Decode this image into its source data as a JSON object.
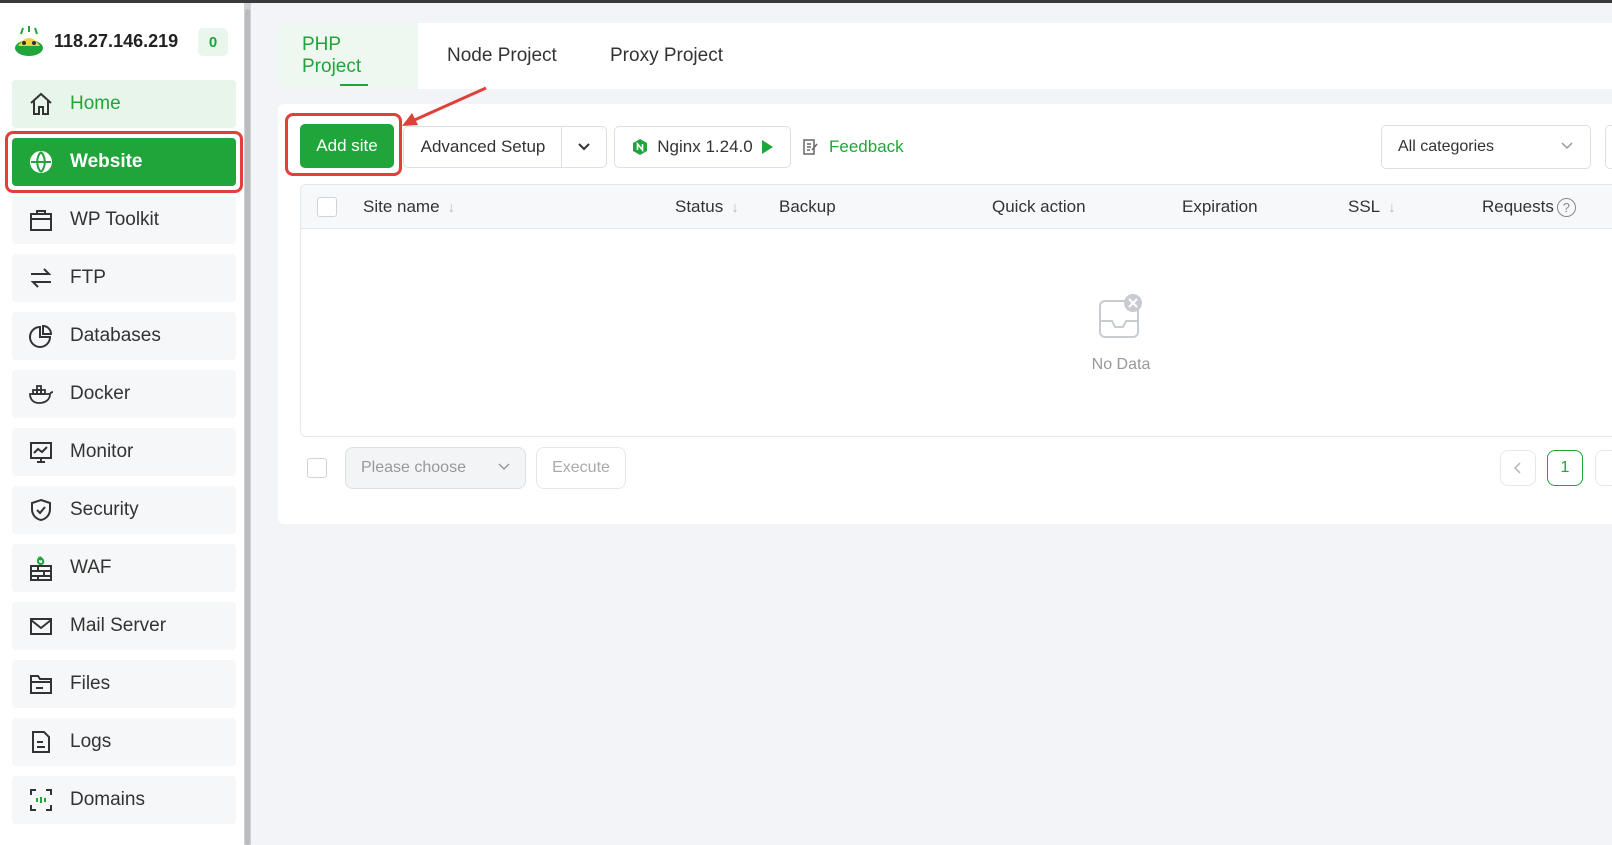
{
  "server": {
    "ip": "118.27.146.219",
    "badge": "0"
  },
  "sidebar": {
    "items": [
      {
        "label": "Home",
        "icon": "home-icon"
      },
      {
        "label": "Website",
        "icon": "globe-icon"
      },
      {
        "label": "WP Toolkit",
        "icon": "toolkit-icon"
      },
      {
        "label": "FTP",
        "icon": "transfer-icon"
      },
      {
        "label": "Databases",
        "icon": "database-icon"
      },
      {
        "label": "Docker",
        "icon": "docker-icon"
      },
      {
        "label": "Monitor",
        "icon": "monitor-icon"
      },
      {
        "label": "Security",
        "icon": "shield-icon"
      },
      {
        "label": "WAF",
        "icon": "firewall-icon"
      },
      {
        "label": "Mail Server",
        "icon": "mail-icon"
      },
      {
        "label": "Files",
        "icon": "folder-icon"
      },
      {
        "label": "Logs",
        "icon": "log-icon"
      },
      {
        "label": "Domains",
        "icon": "domain-icon"
      }
    ]
  },
  "tabs": [
    {
      "label": "PHP Project"
    },
    {
      "label": "Node Project"
    },
    {
      "label": "Proxy Project"
    }
  ],
  "toolbar": {
    "add_site": "Add site",
    "advanced_setup": "Advanced Setup",
    "nginx": "Nginx 1.24.0",
    "feedback": "Feedback",
    "category": "All categories"
  },
  "table": {
    "columns": [
      "Site name",
      "Status",
      "Backup",
      "Quick action",
      "Expiration",
      "SSL",
      "Requests"
    ],
    "empty_text": "No Data"
  },
  "footer": {
    "batch_placeholder": "Please choose",
    "execute": "Execute",
    "current_page": "1"
  },
  "colors": {
    "accent": "#20a53a",
    "highlight": "#e0403a"
  }
}
